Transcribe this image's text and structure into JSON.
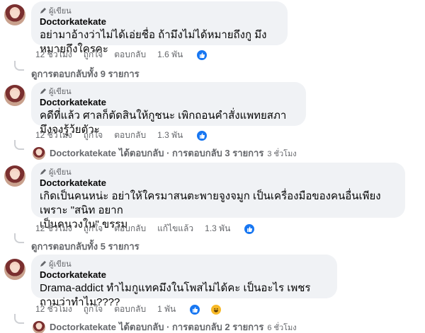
{
  "comments": [
    {
      "badge": "ผู้เขียน",
      "author": "Doctorkatekate",
      "text": "อย่ามาอ้างว่าไม่ได้เอ่ยชื่อ ถ้ามึงไม่ได้หมายถึงกู มึงหมายถึงใครคะ",
      "time": "12 ชั่วโมง",
      "like": "ถูกใจ",
      "reply": "ตอบกลับ",
      "reactions": "1.6 พัน",
      "view_replies": "ดูการตอบกลับทั้ง 9 รายการ"
    },
    {
      "badge": "ผู้เขียน",
      "author": "Doctorkatekate",
      "text": "คดีที่แล้ว ศาลก็ตัดสินให้กูชนะ เพิกถอนคำสั่งแพทยสภา มึงจงรู้ว้ยตัวะ",
      "time": "12 ชั่วโมง",
      "like": "ถูกใจ",
      "reply": "ตอบกลับ",
      "reactions": "1.3 พัน",
      "replied_by": "Doctorkatekate",
      "replied_text": "ได้ตอบกลับ · การตอบกลับ 3 รายการ",
      "replied_time": "3 ชั่วโมง"
    },
    {
      "badge": "ผู้เขียน",
      "author": "Doctorkatekate",
      "text_line1": "เกิดเป็นคนหน่ะ อย่าให้ใครมาสนตะพายจูงจมูก เป็นเครื่องมือของคนอื่นเพียงเพราะ \"สนิท อยาก",
      "text_line2": "เป็นคนวงใน\" ขรรม",
      "time": "12 ชั่วโมง",
      "like": "ถูกใจ",
      "reply": "ตอบกลับ",
      "edited": "แก้ไขแล้ว",
      "reactions": "1.3 พัน",
      "view_replies": "ดูการตอบกลับทั้ง 5 รายการ"
    },
    {
      "badge": "ผู้เขียน",
      "author": "Doctorkatekate",
      "text": "Drama-addict ทำไมกูแทคมึงในโพสไม่ได้คะ เป็นอะไร เพชรถามว่าทำไม????",
      "time": "12 ชั่วโมง",
      "like": "ถูกใจ",
      "reply": "ตอบกลับ",
      "reactions": "1 พัน",
      "replied_by": "Doctorkatekate",
      "replied_text": "ได้ตอบกลับ · การตอบกลับ 2 รายการ",
      "replied_time": "6 ชั่วโมง"
    }
  ]
}
